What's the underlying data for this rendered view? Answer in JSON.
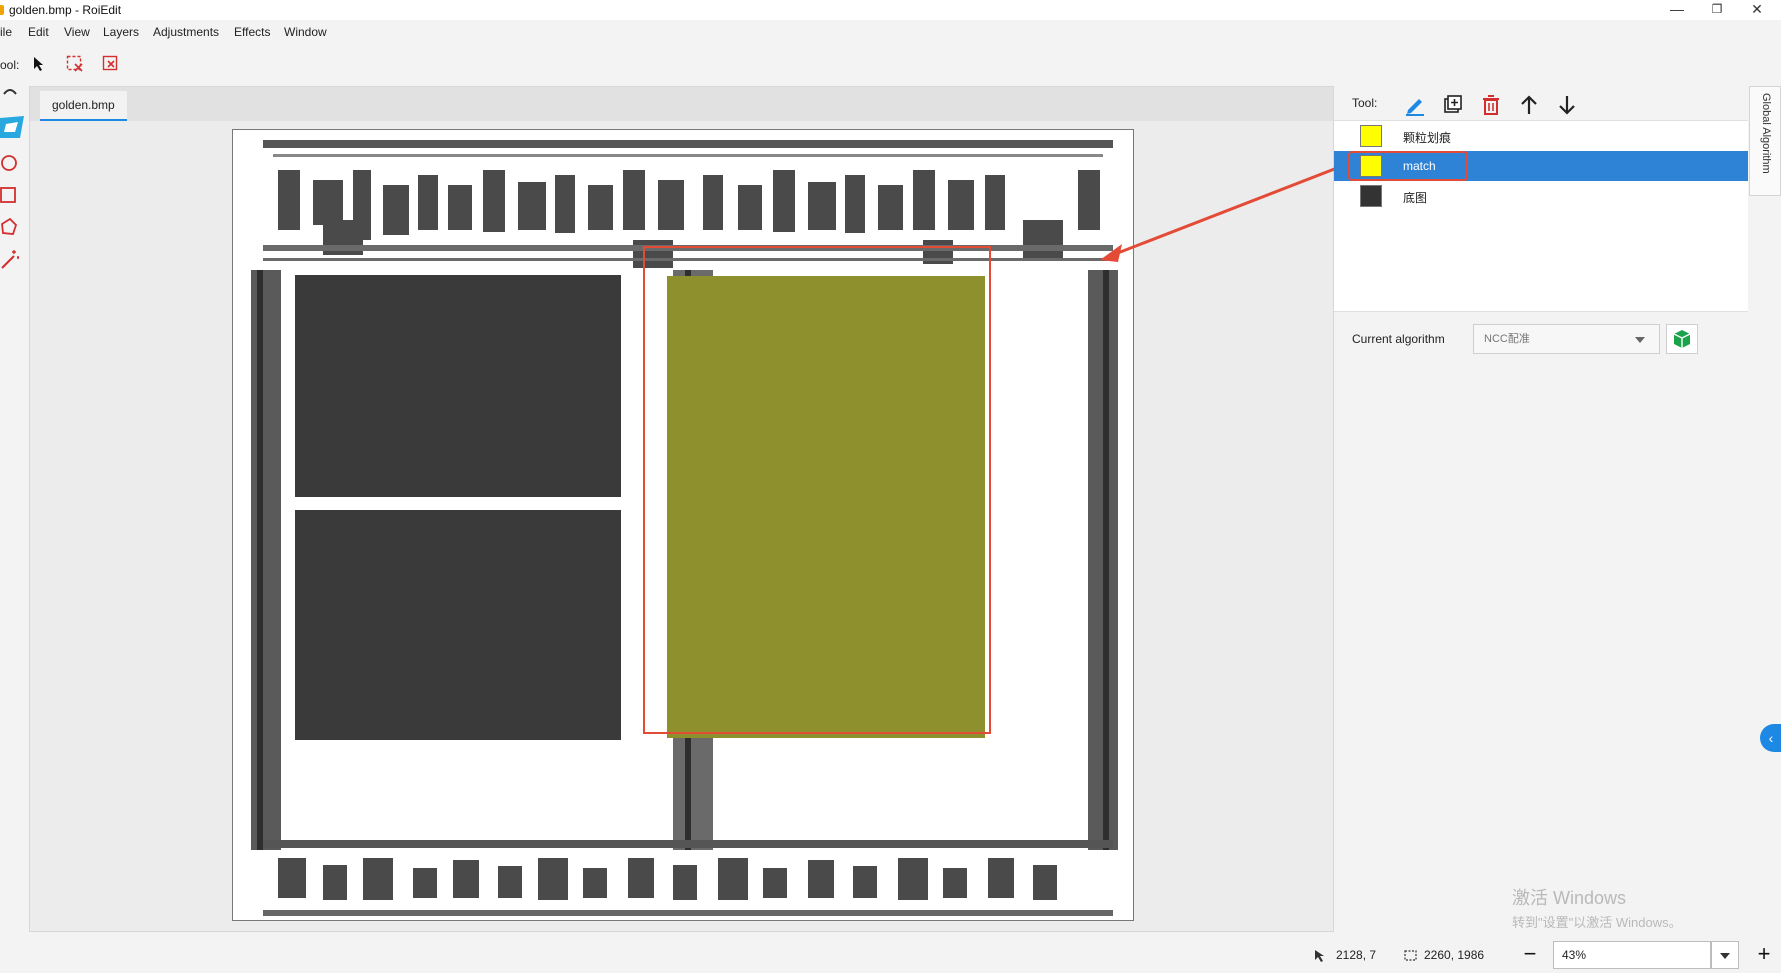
{
  "window": {
    "title": "golden.bmp - RoiEdit",
    "minimize": "—",
    "restore": "❐",
    "close": "✕"
  },
  "menu": [
    "ile",
    "Edit",
    "View",
    "Layers",
    "Adjustments",
    "Effects",
    "Window"
  ],
  "toolbar": {
    "label": "ool:"
  },
  "document": {
    "tab": "golden.bmp"
  },
  "panel": {
    "tool_label": "Tool:",
    "layers": [
      {
        "name": "颗粒划痕",
        "color": "#ffff00",
        "selected": false
      },
      {
        "name": "match",
        "color": "#ffff00",
        "selected": true
      },
      {
        "name": "底图",
        "color": "#333333",
        "selected": false
      }
    ],
    "algorithm_label": "Current algorithm",
    "algorithm_value": "NCC配准",
    "side_tab": "Global Algorithm"
  },
  "watermark": {
    "line1": "激活 Windows",
    "line2": "转到\"设置\"以激活 Windows。"
  },
  "status": {
    "cursor": "2128, 7",
    "size": "2260, 1986",
    "zoom": "43%",
    "zoom_out": "−",
    "zoom_in": "+"
  },
  "colors": {
    "accent": "#1e88e5",
    "selected_row": "#2e83d7",
    "annotation": "#e34b36",
    "roi_fill": "#8e8f2d"
  }
}
